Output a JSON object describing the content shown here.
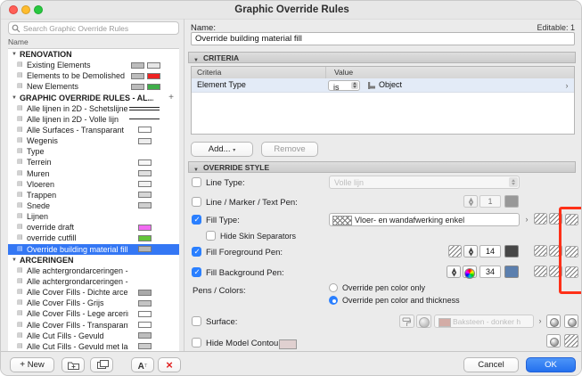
{
  "window": {
    "title": "Graphic Override Rules",
    "editable": "Editable: 1"
  },
  "sidebar": {
    "search_placeholder": "Search Graphic Override Rules",
    "name_column": "Name",
    "rows": [
      {
        "type": "group",
        "label": "RENOVATION"
      },
      {
        "type": "item",
        "label": "Existing Elements",
        "swatches": [
          "#bcbcbc",
          "#e6e6e6"
        ]
      },
      {
        "type": "item",
        "label": "Elements to be Demolished",
        "swatches": [
          "#bcbcbc",
          "#ee2222"
        ]
      },
      {
        "type": "item",
        "label": "New Elements",
        "swatches": [
          "#bcbcbc",
          "#3fae49"
        ]
      },
      {
        "type": "group",
        "label": "GRAPHIC OVERRIDE RULES - AL...",
        "plus": true
      },
      {
        "type": "item",
        "label": "Alle lijnen in 2D - Schetslijnen",
        "line": "double"
      },
      {
        "type": "item",
        "label": "Alle lijnen in 2D - Volle lijn",
        "line": "single"
      },
      {
        "type": "item",
        "label": "Alle Surfaces - Transparant",
        "swatches": [
          "#ffffff"
        ]
      },
      {
        "type": "item",
        "label": "Wegenis",
        "swatches": [
          "#ededed"
        ]
      },
      {
        "type": "item",
        "label": "Type"
      },
      {
        "type": "item",
        "label": "Terrein",
        "swatches": [
          "#f7f7f7"
        ]
      },
      {
        "type": "item",
        "label": "Muren",
        "swatches": [
          "#e0e0e0"
        ]
      },
      {
        "type": "item",
        "label": "Vloeren",
        "swatches": [
          "#f2f2f2"
        ]
      },
      {
        "type": "item",
        "label": "Trappen",
        "swatches": [
          "#d6d6d6"
        ]
      },
      {
        "type": "item",
        "label": "Snede",
        "swatches": [
          "#cfcfcf"
        ]
      },
      {
        "type": "item",
        "label": "Lijnen"
      },
      {
        "type": "item",
        "label": "override draft",
        "swatches": [
          "#f26bf2"
        ]
      },
      {
        "type": "item",
        "label": "override cutfill",
        "swatches": [
          "#63c53a"
        ]
      },
      {
        "type": "item",
        "label": "Override building material fill",
        "selected": true,
        "swatches": [
          "#b5b5b5"
        ]
      },
      {
        "type": "group",
        "label": "ARCERINGEN"
      },
      {
        "type": "item",
        "label": "Alle achtergrondarceringen - Trans..."
      },
      {
        "type": "item",
        "label": "Alle achtergrondarceringen - Wind..."
      },
      {
        "type": "item",
        "label": "Alle Cover Fills - Dichte arcering",
        "swatches": [
          "#a9a9a9"
        ]
      },
      {
        "type": "item",
        "label": "Alle Cover Fills - Grijs",
        "swatches": [
          "#c4c4c4"
        ]
      },
      {
        "type": "item",
        "label": "Alle Cover Fills - Lege arcering",
        "swatches": [
          "#ffffff"
        ]
      },
      {
        "type": "item",
        "label": "Alle Cover Fills - Transparant",
        "swatches": [
          "#ffffff"
        ]
      },
      {
        "type": "item",
        "label": "Alle Cut Fills - Gevuld",
        "swatches": [
          "#bdbdbd"
        ]
      },
      {
        "type": "item",
        "label": "Alle Cut Fills - Gevuld met laagogh",
        "swatches": [
          "#cccccc"
        ]
      }
    ],
    "toolbar": {
      "new": "New"
    }
  },
  "name_field": {
    "label": "Name:",
    "value": "Override building material fill"
  },
  "criteria": {
    "title": "CRITERIA",
    "columns": {
      "criteria": "Criteria",
      "value": "Value"
    },
    "row": {
      "field": "Element Type",
      "operator": "is",
      "value": "Object"
    },
    "add": "Add...",
    "remove": "Remove"
  },
  "override": {
    "title": "OVERRIDE STYLE",
    "line_type": {
      "label": "Line Type:",
      "value": "Volle lijn",
      "checked": false
    },
    "line_pen": {
      "label": "Line / Marker / Text Pen:",
      "value": "1",
      "checked": false
    },
    "fill_type": {
      "label": "Fill Type:",
      "value": "Vloer- en wandafwerking enkel",
      "checked": true
    },
    "hide_skin": {
      "label": "Hide Skin Separators",
      "checked": false
    },
    "fill_fg": {
      "label": "Fill Foreground Pen:",
      "value": "14",
      "checked": true
    },
    "fill_bg": {
      "label": "Fill Background Pen:",
      "value": "34",
      "checked": true
    },
    "pens_colors": {
      "label": "Pens / Colors:",
      "option1": "Override pen color only",
      "option1_on": false,
      "option2": "Override pen color and thickness",
      "option2_on": true
    },
    "surface": {
      "label": "Surface:",
      "value": "Baksteen - donker halfsteens",
      "checked": false
    },
    "hide_contours": {
      "label": "Hide Model Contours:",
      "checked": false
    }
  },
  "actions": {
    "cancel": "Cancel",
    "ok": "OK"
  },
  "icons": {
    "pen_column": "✎",
    "fill_column": "▨",
    "surface_column": "●",
    "rule_item": "▤",
    "disclosure": "▼",
    "drill": "›",
    "plus": "+"
  },
  "colors": {
    "selected_row": "#3477f4",
    "ok_button": "#2470ee",
    "checkbox_accent": "#2a7fff",
    "annotation": "#ff3018",
    "pen_1_swatch": "#555555",
    "pen_14_swatch": "#474747",
    "pen_34_swatch": "#5b7fae",
    "demolish_red": "#ee2222",
    "new_green": "#3fae49",
    "draft_magenta": "#f26bf2",
    "cutfill_green": "#63c53a",
    "surface_brick": "#c17a6f"
  }
}
